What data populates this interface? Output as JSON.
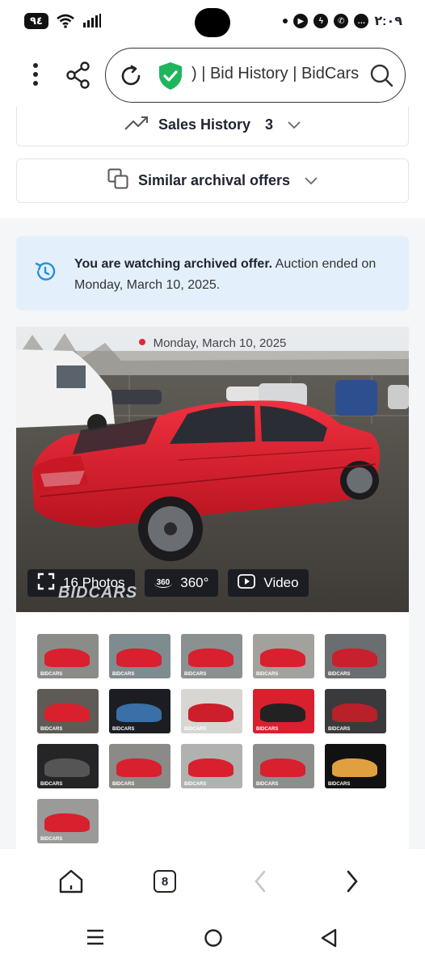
{
  "status_bar": {
    "battery": "٩٤",
    "time": "٢:٠٩"
  },
  "browser": {
    "url_text": ") | Bid History | BidCars",
    "tab_count": "8"
  },
  "accordion": {
    "sales_history_label": "Sales History",
    "sales_history_count": "3",
    "similar_offers_label": "Similar archival offers"
  },
  "notice": {
    "bold": "You are watching archived offer.",
    "rest": " Auction ended on Monday, March 10, 2025."
  },
  "photo": {
    "date": "Monday, March 10, 2025",
    "photos_label": "16 Photos",
    "view360_label": "360°",
    "view360_badge": "360",
    "video_label": "Video",
    "watermark": "BIDCARS",
    "thumb_brand": "BIDCARS"
  },
  "colors": {
    "notice_bg": "#e3f0fb",
    "shield": "#1fb55c",
    "car_red": "#d8202e",
    "date_dot": "#e0283a"
  },
  "icons": [
    "more-vert-icon",
    "share-icon",
    "reload-icon",
    "shield-check-icon",
    "search-icon",
    "trending-up-icon",
    "chevron-down-icon",
    "copy-icon",
    "history-icon",
    "expand-icon",
    "view-360-icon",
    "play-icon",
    "home-icon",
    "back-icon",
    "forward-icon",
    "recents-icon",
    "home-circle-icon",
    "nav-back-icon"
  ]
}
